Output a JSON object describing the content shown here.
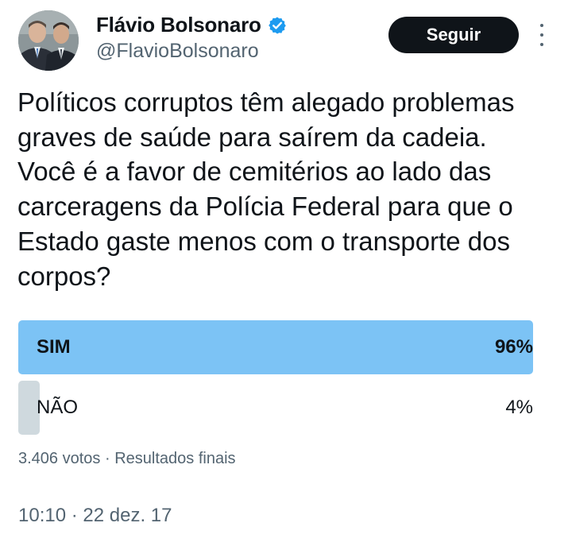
{
  "author": {
    "name": "Flávio Bolsonaro",
    "handle": "@FlavioBolsonaro",
    "verified": true,
    "verified_color": "#1d9bf0"
  },
  "follow_button": {
    "label": "Seguir"
  },
  "more_icon": "more-vertical-icon",
  "tweet": {
    "lines": [
      "Políticos corruptos têm alegado problemas",
      "graves de saúde para saírem da cadeia.",
      "Você é a favor de cemitérios ao lado das",
      "carceragens da Polícia Federal para que o",
      "Estado gaste menos com o transporte dos",
      "corpos?"
    ]
  },
  "poll": {
    "options": [
      {
        "label": "SIM",
        "percent": "96%",
        "fraction": 0.96,
        "winner": true,
        "color": "#7cc3f5"
      },
      {
        "label": "NÃO",
        "percent": "4%",
        "fraction": 0.04,
        "winner": false,
        "color": "#cfd9de"
      }
    ],
    "votes": "3.406 votos",
    "separator": "·",
    "status": "Resultados finais"
  },
  "timestamp": "10:10 · 22 dez. 17"
}
